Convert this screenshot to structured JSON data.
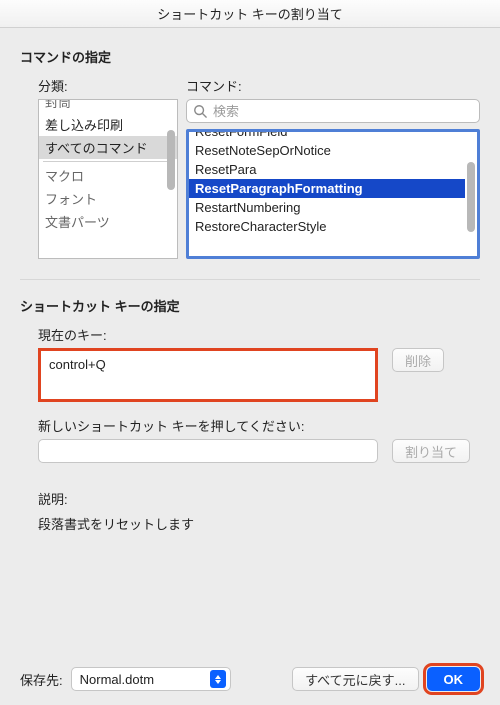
{
  "window": {
    "title": "ショートカット キーの割り当て"
  },
  "sections": {
    "command_spec": "コマンドの指定",
    "shortcut_spec": "ショートカット キーの指定"
  },
  "labels": {
    "category": "分類:",
    "command": "コマンド:",
    "current_keys": "現在のキー:",
    "press_new": "新しいショートカット キーを押してください:",
    "description": "説明:",
    "save_in": "保存先:"
  },
  "categories": {
    "items": [
      "封筒",
      "差し込み印刷",
      "すべてのコマンド",
      "マクロ",
      "フォント",
      "文書パーツ"
    ],
    "selected_index": 2
  },
  "search": {
    "placeholder": "検索"
  },
  "commands": {
    "items": [
      "ResetFormField",
      "ResetNoteSepOrNotice",
      "ResetPara",
      "ResetParagraphFormatting",
      "RestartNumbering",
      "RestoreCharacterStyle"
    ],
    "selected_index": 3
  },
  "current_keys": {
    "value": "control+Q"
  },
  "new_key": {
    "value": ""
  },
  "description_text": "段落書式をリセットします",
  "buttons": {
    "remove": "削除",
    "assign": "割り当て",
    "reset_all": "すべて元に戻す...",
    "ok": "OK"
  },
  "save_in": {
    "value": "Normal.dotm"
  }
}
